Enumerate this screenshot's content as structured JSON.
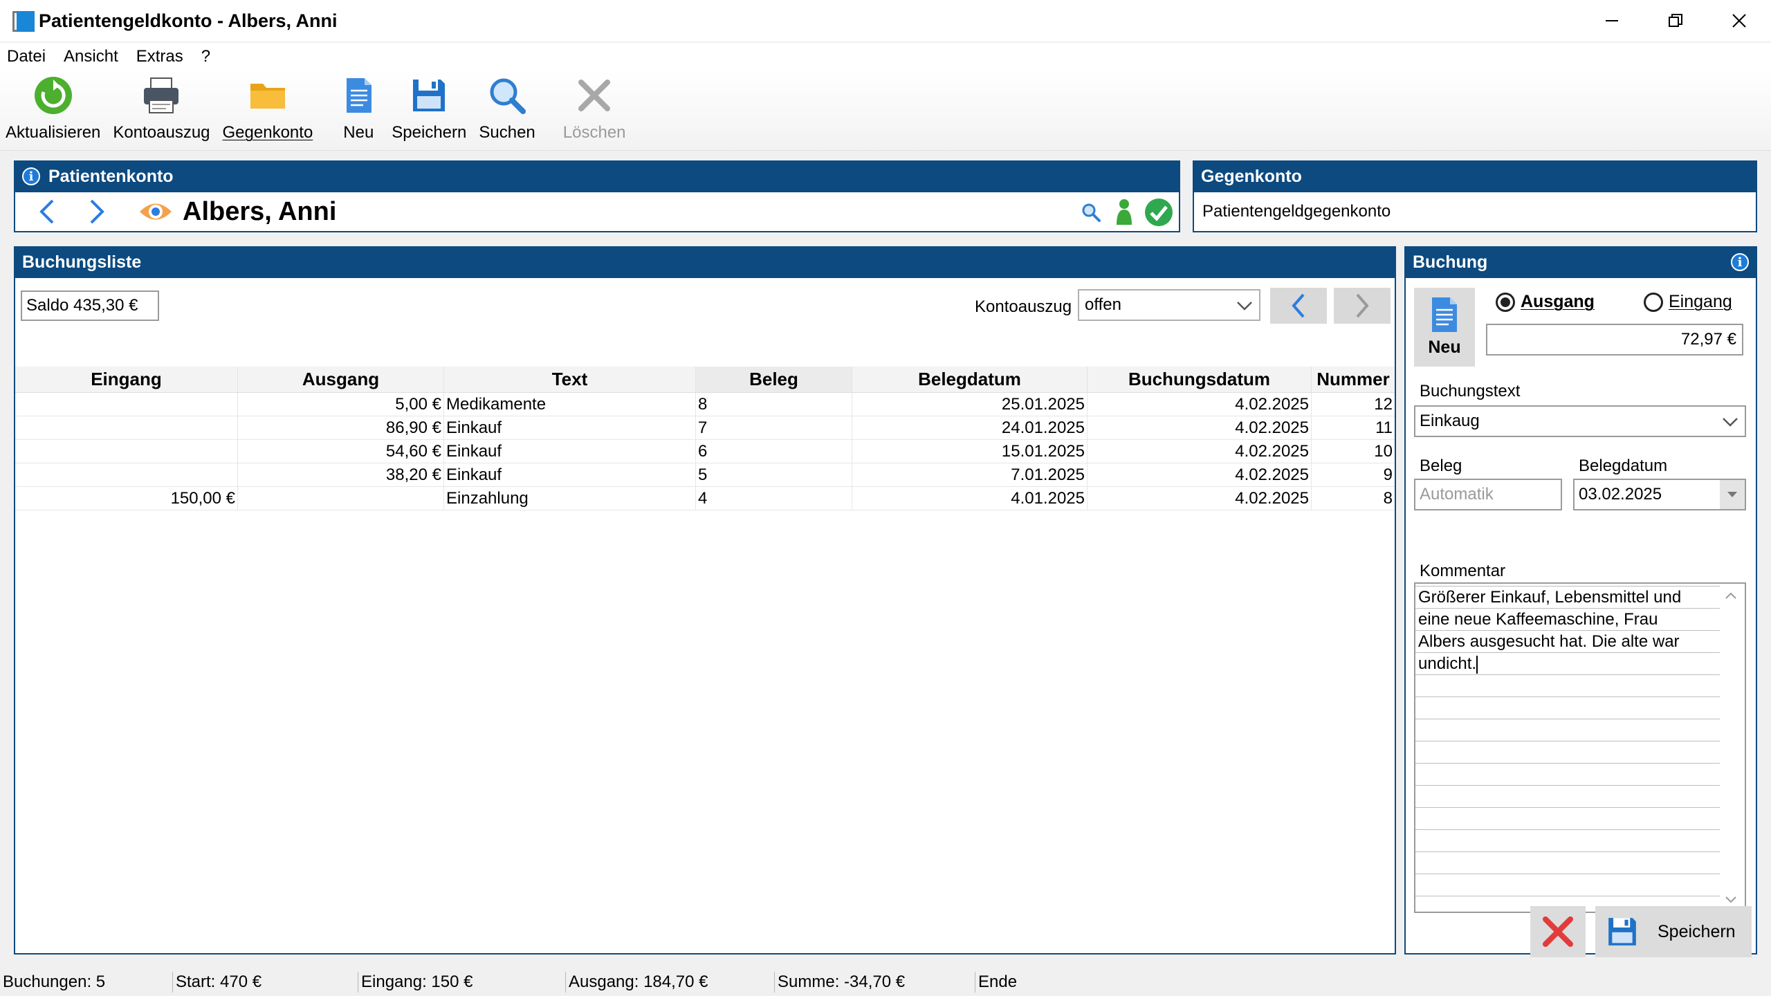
{
  "window": {
    "title": "Patientengeldkonto - Albers, Anni"
  },
  "menu": [
    "Datei",
    "Ansicht",
    "Extras",
    "?"
  ],
  "toolbar": [
    {
      "label": "Aktualisieren",
      "icon": "refresh-icon"
    },
    {
      "label": "Kontoauszug",
      "icon": "printer-icon"
    },
    {
      "label": "Gegenkonto",
      "icon": "folder-icon"
    },
    {
      "label": "Neu",
      "icon": "new-document-icon"
    },
    {
      "label": "Speichern",
      "icon": "floppy-disk-icon"
    },
    {
      "label": "Suchen",
      "icon": "magnifier-icon"
    },
    {
      "label": "Löschen",
      "icon": "delete-x-icon",
      "disabled": true
    }
  ],
  "patient": {
    "header": "Patientenkonto",
    "name": "Albers, Anni"
  },
  "gegenkonto": {
    "header": "Gegenkonto",
    "value": "Patientengeldgegenkonto"
  },
  "liste": {
    "header": "Buchungsliste",
    "saldo": "Saldo 435,30 €",
    "kontoauszug_label": "Kontoauszug",
    "kontoauszug_value": "offen",
    "columns": [
      "Eingang",
      "Ausgang",
      "Text",
      "Beleg",
      "Belegdatum",
      "Buchungsdatum",
      "Nummer"
    ],
    "rows": [
      {
        "eingang": "",
        "ausgang": "5,00 €",
        "text": "Medikamente",
        "beleg": "8",
        "belegdatum": "25.01.2025",
        "buchungsdatum": "4.02.2025",
        "nummer": "12"
      },
      {
        "eingang": "",
        "ausgang": "86,90 €",
        "text": "Einkauf",
        "beleg": "7",
        "belegdatum": "24.01.2025",
        "buchungsdatum": "4.02.2025",
        "nummer": "11"
      },
      {
        "eingang": "",
        "ausgang": "54,60 €",
        "text": "Einkauf",
        "beleg": "6",
        "belegdatum": "15.01.2025",
        "buchungsdatum": "4.02.2025",
        "nummer": "10"
      },
      {
        "eingang": "",
        "ausgang": "38,20 €",
        "text": "Einkauf",
        "beleg": "5",
        "belegdatum": "7.01.2025",
        "buchungsdatum": "4.02.2025",
        "nummer": "9"
      },
      {
        "eingang": "150,00 €",
        "ausgang": "",
        "text": "Einzahlung",
        "beleg": "4",
        "belegdatum": "4.01.2025",
        "buchungsdatum": "4.02.2025",
        "nummer": "8"
      }
    ]
  },
  "buchung": {
    "header": "Buchung",
    "neu_label": "Neu",
    "radio_ausgang": "Ausgang",
    "radio_eingang": "Eingang",
    "selected": "Ausgang",
    "betrag": "72,97 €",
    "buchungstext_label": "Buchungstext",
    "buchungstext_value": "Einkaug",
    "beleg_label": "Beleg",
    "beleg_placeholder": "Automatik",
    "belegdatum_label": "Belegdatum",
    "belegdatum_value": "03.02.2025",
    "kommentar_label": "Kommentar",
    "kommentar_lines": [
      "Größerer Einkauf, Lebensmittel und",
      "eine neue Kaffeemaschine, Frau",
      "Albers ausgesucht hat. Die alte war",
      "undicht."
    ],
    "save_label": "Speichern"
  },
  "status": {
    "buchungen": "Buchungen: 5",
    "start": "Start: 470 €",
    "eingang": "Eingang: 150 €",
    "ausgang": "Ausgang: 184,70 €",
    "summe": "Summe: -34,70 €",
    "ende": "Ende"
  },
  "colors": {
    "header_blue": "#0c4a80",
    "accent_blue": "#1e7bd8",
    "ok_green": "#2fa84f",
    "cancel_red": "#e23b3b"
  }
}
